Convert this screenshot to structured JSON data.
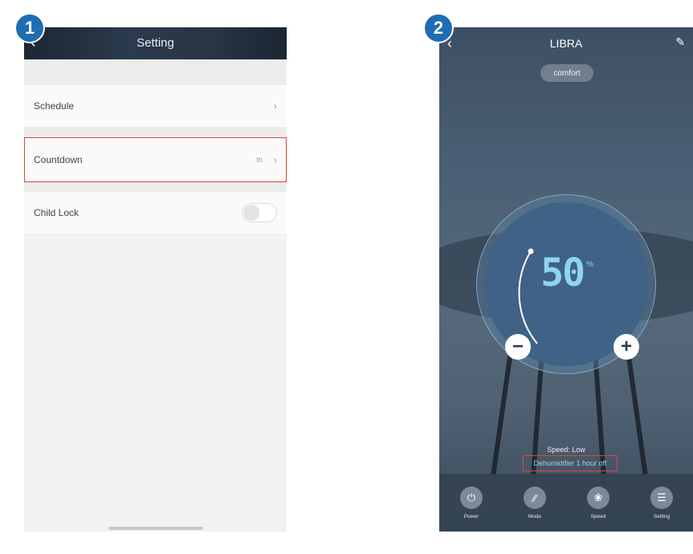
{
  "steps": [
    "1",
    "2"
  ],
  "setting_screen": {
    "header": {
      "back_icon": "chevron-left-icon",
      "title": "Setting"
    },
    "rows": [
      {
        "label": "Schedule",
        "value": ""
      },
      {
        "label": "Countdown",
        "value": "th"
      },
      {
        "label": "Child Lock",
        "toggle_on": false
      }
    ],
    "highlight_color": "#e0443e"
  },
  "device_screen": {
    "header": {
      "back_icon": "chevron-left-icon",
      "title": "LIBRA",
      "edit_icon": "pencil-icon"
    },
    "mode_pill": "comfort",
    "dial": {
      "value": "50",
      "unit": "%"
    },
    "speed_text": "Speed: Low",
    "dehumidifier_text": "Dehumidifier 1 hour off",
    "bottom_bar": [
      {
        "label": "Power",
        "icon": "power-icon"
      },
      {
        "label": "Mode",
        "icon": "mode-icon"
      },
      {
        "label": "Speed",
        "icon": "fan-icon"
      },
      {
        "label": "Setting",
        "icon": "setting-icon"
      }
    ],
    "accent_color": "#8fd3f2"
  }
}
